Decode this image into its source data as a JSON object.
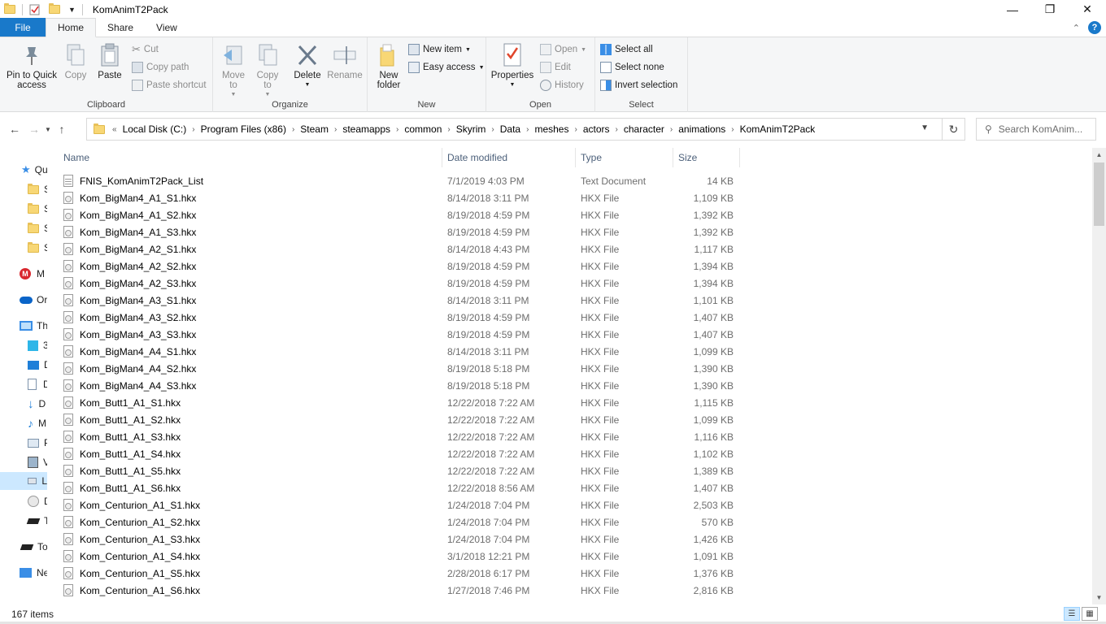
{
  "window": {
    "title": "KomAnimT2Pack",
    "minimize_icon": "minimize-icon",
    "maximize_icon": "restore-icon",
    "close_icon": "close-icon"
  },
  "ribbon_tabs": [
    "File",
    "Home",
    "Share",
    "View"
  ],
  "ribbon": {
    "clipboard": {
      "label": "Clipboard",
      "pin": "Pin to Quick access",
      "copy": "Copy",
      "paste": "Paste",
      "cut": "Cut",
      "copy_path": "Copy path",
      "paste_shortcut": "Paste shortcut"
    },
    "organize": {
      "label": "Organize",
      "move_to": "Move to",
      "copy_to": "Copy to",
      "delete": "Delete",
      "rename": "Rename"
    },
    "new": {
      "label": "New",
      "new_folder": "New folder",
      "new_item": "New item",
      "easy_access": "Easy access"
    },
    "open": {
      "label": "Open",
      "properties": "Properties",
      "open": "Open",
      "edit": "Edit",
      "history": "History"
    },
    "select": {
      "label": "Select",
      "select_all": "Select all",
      "select_none": "Select none",
      "invert_selection": "Invert selection"
    }
  },
  "breadcrumb": [
    "Local Disk (C:)",
    "Program Files (x86)",
    "Steam",
    "steamapps",
    "common",
    "Skyrim",
    "Data",
    "meshes",
    "actors",
    "character",
    "animations",
    "KomAnimT2Pack"
  ],
  "search": {
    "placeholder": "Search KomAnim..."
  },
  "nav_pane": [
    {
      "label": "Qu",
      "icon": "star-icon"
    },
    {
      "label": "S",
      "icon": "folder-icon"
    },
    {
      "label": "S",
      "icon": "folder-icon"
    },
    {
      "label": "S",
      "icon": "folder-icon"
    },
    {
      "label": "S",
      "icon": "folder-icon"
    },
    {
      "label": "M",
      "icon": "mega-icon"
    },
    {
      "label": "Or",
      "icon": "cloud-icon"
    },
    {
      "label": "Th",
      "icon": "computer-icon"
    },
    {
      "label": "3",
      "icon": "cube-icon"
    },
    {
      "label": "D",
      "icon": "desktop-icon"
    },
    {
      "label": "D",
      "icon": "documents-icon"
    },
    {
      "label": "D",
      "icon": "downloads-icon"
    },
    {
      "label": "M",
      "icon": "music-icon"
    },
    {
      "label": "P",
      "icon": "pictures-icon"
    },
    {
      "label": "V",
      "icon": "videos-icon"
    },
    {
      "label": "L",
      "icon": "disk-icon"
    },
    {
      "label": "D",
      "icon": "dvd-icon"
    },
    {
      "label": "T",
      "icon": "drive-icon"
    },
    {
      "label": "To",
      "icon": "drive-icon"
    },
    {
      "label": "Ne",
      "icon": "network-icon"
    }
  ],
  "columns": {
    "name": "Name",
    "date": "Date modified",
    "type": "Type",
    "size": "Size"
  },
  "files": [
    {
      "name": "FNIS_KomAnimT2Pack_List",
      "date": "7/1/2019 4:03 PM",
      "type": "Text Document",
      "size": "14 KB"
    },
    {
      "name": "Kom_BigMan4_A1_S1.hkx",
      "date": "8/14/2018 3:11 PM",
      "type": "HKX File",
      "size": "1,109 KB"
    },
    {
      "name": "Kom_BigMan4_A1_S2.hkx",
      "date": "8/19/2018 4:59 PM",
      "type": "HKX File",
      "size": "1,392 KB"
    },
    {
      "name": "Kom_BigMan4_A1_S3.hkx",
      "date": "8/19/2018 4:59 PM",
      "type": "HKX File",
      "size": "1,392 KB"
    },
    {
      "name": "Kom_BigMan4_A2_S1.hkx",
      "date": "8/14/2018 4:43 PM",
      "type": "HKX File",
      "size": "1,117 KB"
    },
    {
      "name": "Kom_BigMan4_A2_S2.hkx",
      "date": "8/19/2018 4:59 PM",
      "type": "HKX File",
      "size": "1,394 KB"
    },
    {
      "name": "Kom_BigMan4_A2_S3.hkx",
      "date": "8/19/2018 4:59 PM",
      "type": "HKX File",
      "size": "1,394 KB"
    },
    {
      "name": "Kom_BigMan4_A3_S1.hkx",
      "date": "8/14/2018 3:11 PM",
      "type": "HKX File",
      "size": "1,101 KB"
    },
    {
      "name": "Kom_BigMan4_A3_S2.hkx",
      "date": "8/19/2018 4:59 PM",
      "type": "HKX File",
      "size": "1,407 KB"
    },
    {
      "name": "Kom_BigMan4_A3_S3.hkx",
      "date": "8/19/2018 4:59 PM",
      "type": "HKX File",
      "size": "1,407 KB"
    },
    {
      "name": "Kom_BigMan4_A4_S1.hkx",
      "date": "8/14/2018 3:11 PM",
      "type": "HKX File",
      "size": "1,099 KB"
    },
    {
      "name": "Kom_BigMan4_A4_S2.hkx",
      "date": "8/19/2018 5:18 PM",
      "type": "HKX File",
      "size": "1,390 KB"
    },
    {
      "name": "Kom_BigMan4_A4_S3.hkx",
      "date": "8/19/2018 5:18 PM",
      "type": "HKX File",
      "size": "1,390 KB"
    },
    {
      "name": "Kom_Butt1_A1_S1.hkx",
      "date": "12/22/2018 7:22 AM",
      "type": "HKX File",
      "size": "1,115 KB"
    },
    {
      "name": "Kom_Butt1_A1_S2.hkx",
      "date": "12/22/2018 7:22 AM",
      "type": "HKX File",
      "size": "1,099 KB"
    },
    {
      "name": "Kom_Butt1_A1_S3.hkx",
      "date": "12/22/2018 7:22 AM",
      "type": "HKX File",
      "size": "1,116 KB"
    },
    {
      "name": "Kom_Butt1_A1_S4.hkx",
      "date": "12/22/2018 7:22 AM",
      "type": "HKX File",
      "size": "1,102 KB"
    },
    {
      "name": "Kom_Butt1_A1_S5.hkx",
      "date": "12/22/2018 7:22 AM",
      "type": "HKX File",
      "size": "1,389 KB"
    },
    {
      "name": "Kom_Butt1_A1_S6.hkx",
      "date": "12/22/2018 8:56 AM",
      "type": "HKX File",
      "size": "1,407 KB"
    },
    {
      "name": "Kom_Centurion_A1_S1.hkx",
      "date": "1/24/2018 7:04 PM",
      "type": "HKX File",
      "size": "2,503 KB"
    },
    {
      "name": "Kom_Centurion_A1_S2.hkx",
      "date": "1/24/2018 7:04 PM",
      "type": "HKX File",
      "size": "570 KB"
    },
    {
      "name": "Kom_Centurion_A1_S3.hkx",
      "date": "1/24/2018 7:04 PM",
      "type": "HKX File",
      "size": "1,426 KB"
    },
    {
      "name": "Kom_Centurion_A1_S4.hkx",
      "date": "3/1/2018 12:21 PM",
      "type": "HKX File",
      "size": "1,091 KB"
    },
    {
      "name": "Kom_Centurion_A1_S5.hkx",
      "date": "2/28/2018 6:17 PM",
      "type": "HKX File",
      "size": "1,376 KB"
    },
    {
      "name": "Kom_Centurion_A1_S6.hkx",
      "date": "1/27/2018 7:46 PM",
      "type": "HKX File",
      "size": "2,816 KB"
    }
  ],
  "status": {
    "item_count": "167 items"
  },
  "colors": {
    "accent": "#1979ca",
    "selection": "#cce8ff",
    "folder": "#f8d775"
  }
}
